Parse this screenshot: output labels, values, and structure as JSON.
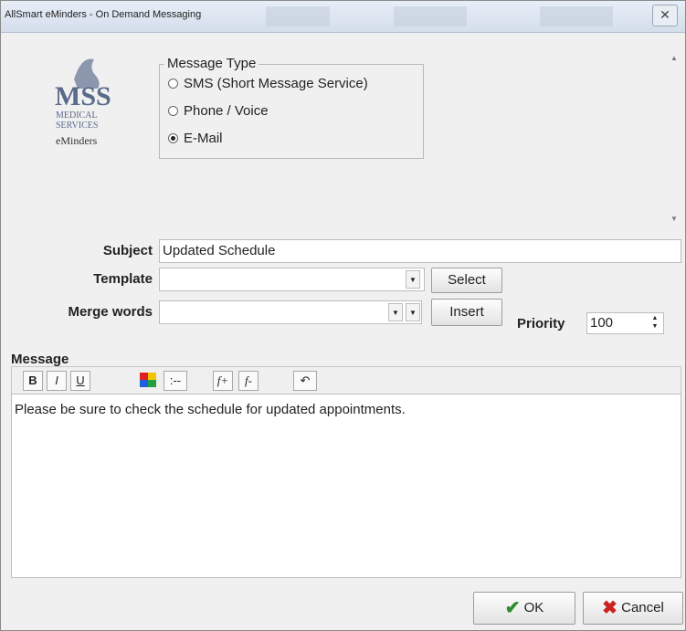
{
  "window": {
    "title": "AllSmart eMinders - On Demand Messaging",
    "close_glyph": "✕"
  },
  "logo": {
    "text_main": "MSS",
    "text_sub1": "MEDICAL",
    "text_sub2": "SERVICES",
    "text_caption": "eMinders"
  },
  "message_type": {
    "legend": "Message Type",
    "options": [
      {
        "label": "SMS (Short Message Service)",
        "selected": false
      },
      {
        "label": "Phone / Voice",
        "selected": false
      },
      {
        "label": "E-Mail",
        "selected": true
      }
    ]
  },
  "form": {
    "subject_label": "Subject",
    "subject_value": "Updated Schedule",
    "template_label": "Template",
    "template_value": "",
    "select_button": "Select",
    "merge_label": "Merge words",
    "merge_value": "",
    "insert_button": "Insert",
    "priority_label": "Priority",
    "priority_value": "100"
  },
  "message": {
    "label": "Message",
    "toolbar": {
      "bold": "B",
      "italic": "I",
      "underline": "U",
      "bullets": ":--",
      "font_up": "f+",
      "font_down": "f-",
      "undo": "↶"
    },
    "body": "Please be sure to check the schedule for updated appointments."
  },
  "actions": {
    "ok": "OK",
    "cancel": "Cancel"
  },
  "colors": {
    "ok_check": "#2e8b2e",
    "cancel_x": "#cc2222",
    "logo_blue": "#5a6a8a"
  }
}
